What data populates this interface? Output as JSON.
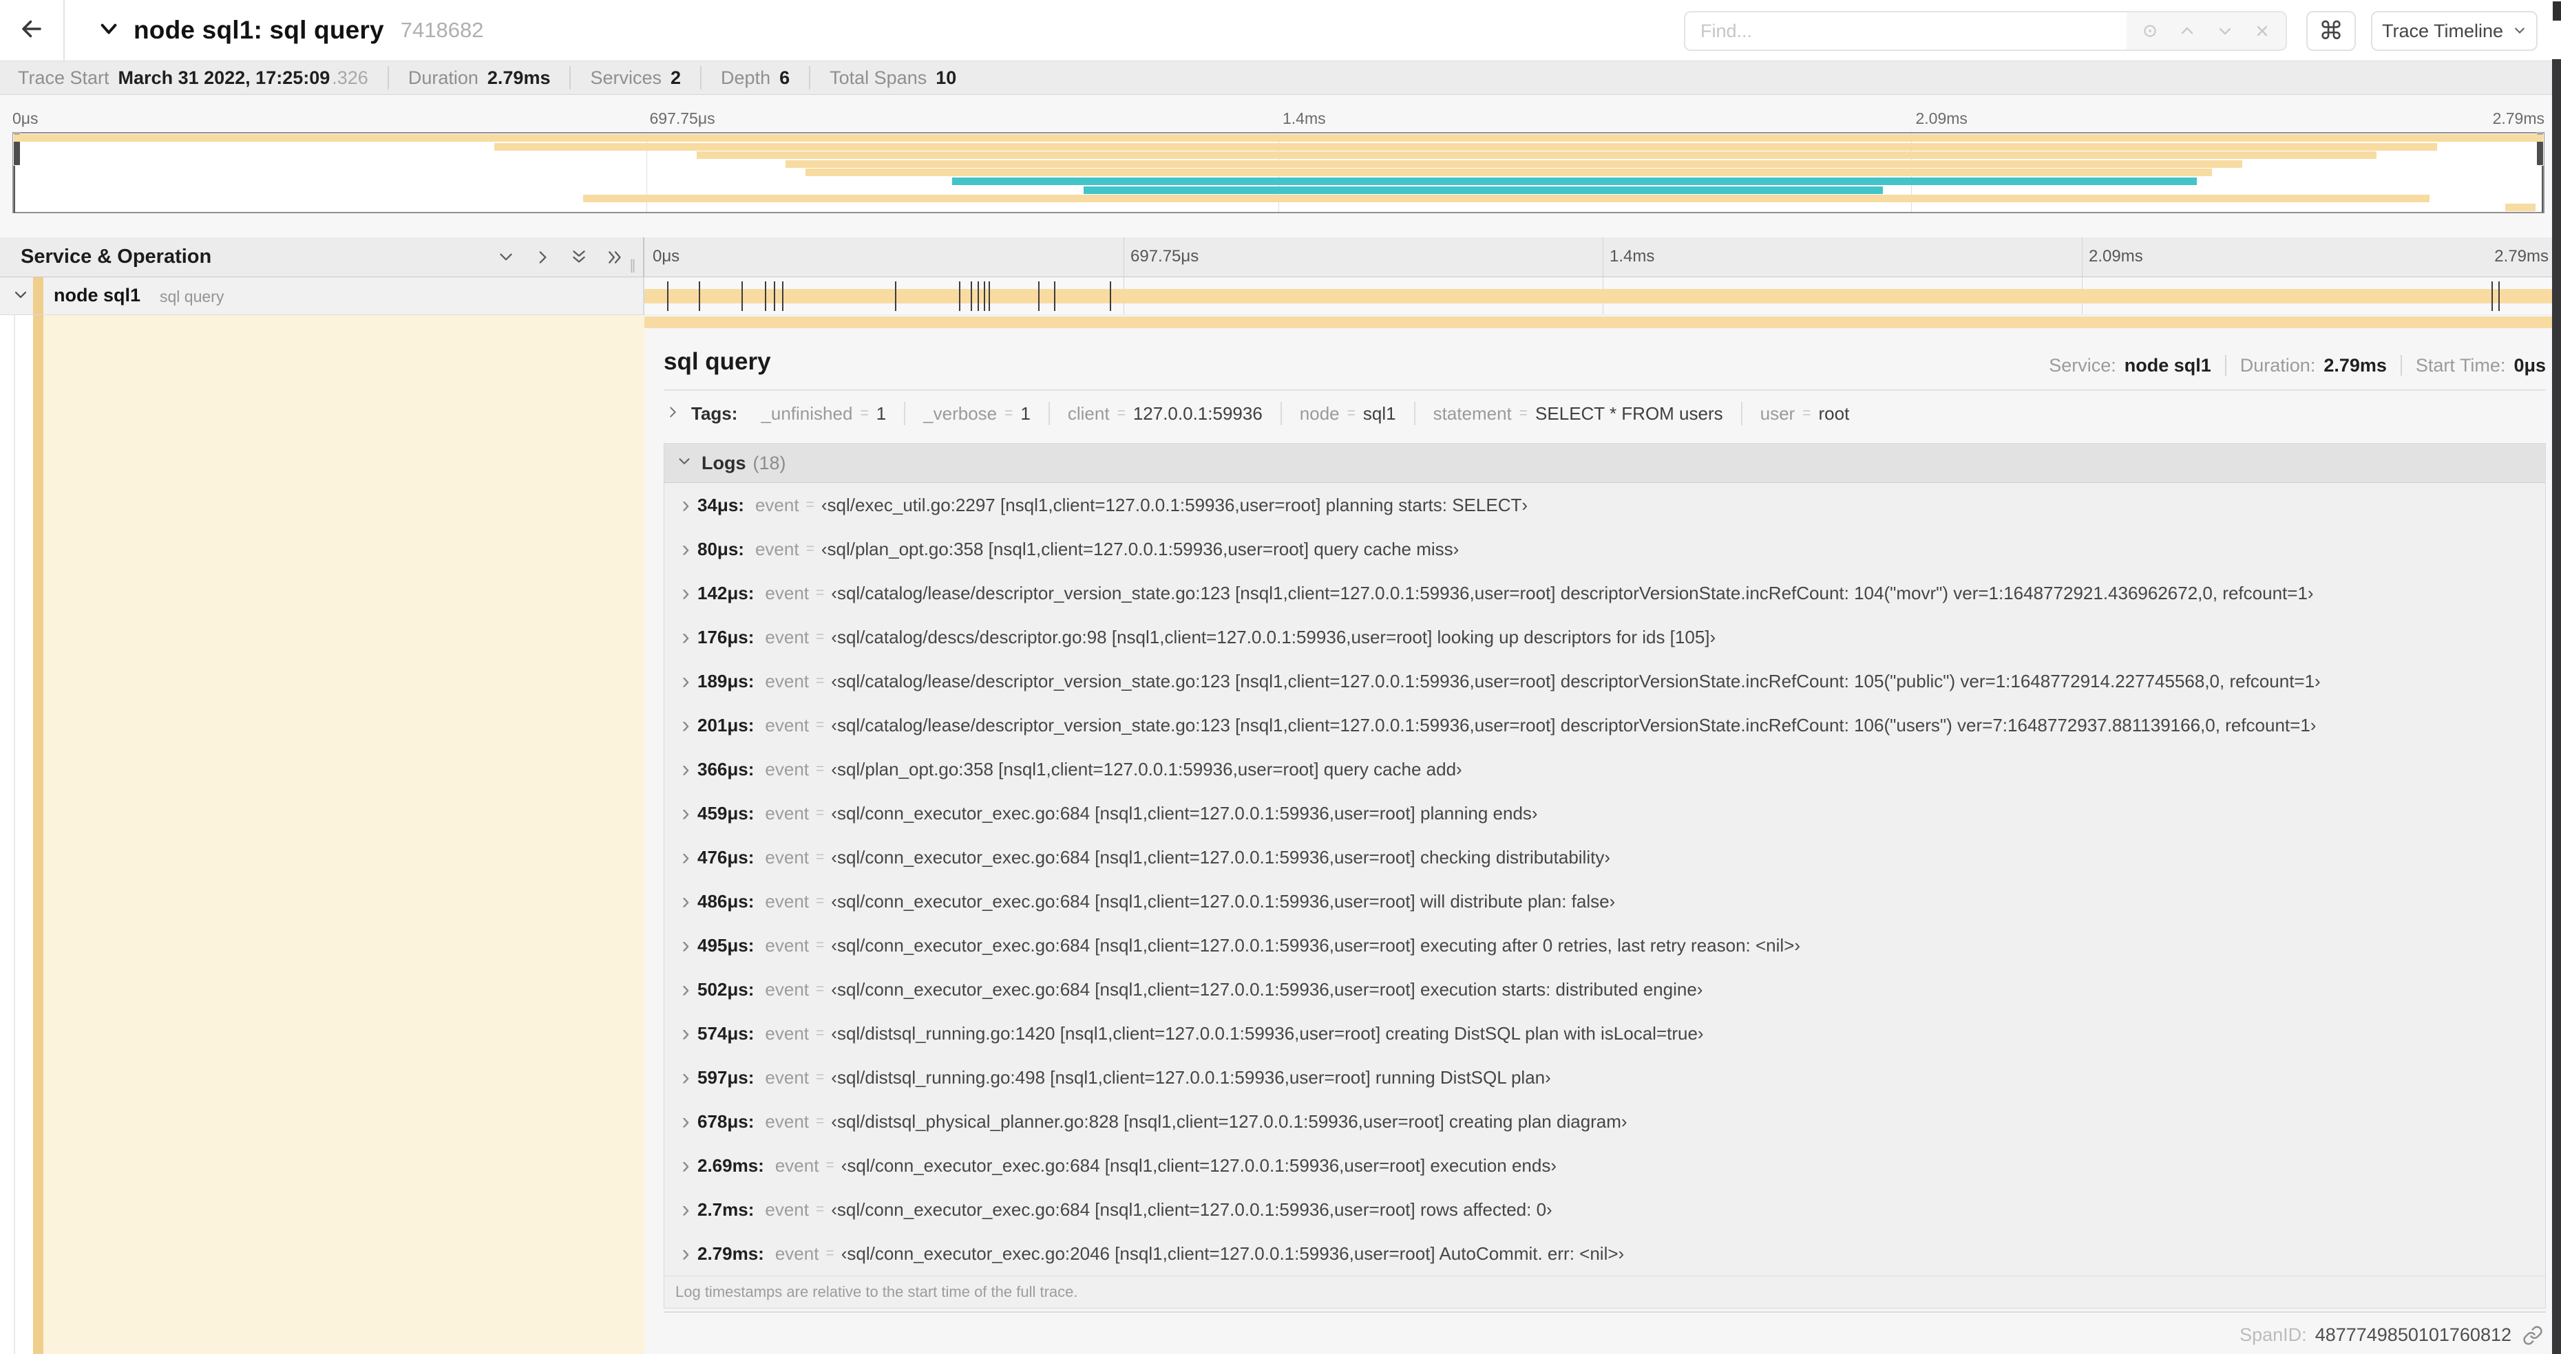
{
  "header": {
    "title": "node sql1: sql query",
    "trace_id": "7418682",
    "find_placeholder": "Find...",
    "command_key_glyph": "⌘",
    "view_selector_label": "Trace Timeline"
  },
  "trace_stats": {
    "trace_start_label": "Trace Start",
    "trace_start_value": "March 31 2022, 17:25:09",
    "trace_start_fraction": ".326",
    "duration_label": "Duration",
    "duration_value": "2.79ms",
    "services_label": "Services",
    "services_value": "2",
    "depth_label": "Depth",
    "depth_value": "6",
    "total_spans_label": "Total Spans",
    "total_spans_value": "10"
  },
  "minimap": {
    "tick_labels": [
      "0μs",
      "697.75μs",
      "1.4ms",
      "2.09ms",
      "2.79ms"
    ],
    "spans": [
      {
        "row": 0,
        "start": 0.0,
        "end": 1.0,
        "color": "tan"
      },
      {
        "row": 1,
        "start": 0.19,
        "end": 0.958,
        "color": "tan"
      },
      {
        "row": 2,
        "start": 0.27,
        "end": 0.934,
        "color": "tan"
      },
      {
        "row": 3,
        "start": 0.305,
        "end": 0.881,
        "color": "tan"
      },
      {
        "row": 4,
        "start": 0.313,
        "end": 0.869,
        "color": "tan"
      },
      {
        "row": 5,
        "start": 0.371,
        "end": 0.863,
        "color": "teal"
      },
      {
        "row": 6,
        "start": 0.423,
        "end": 0.739,
        "color": "teal"
      },
      {
        "row": 7,
        "start": 0.225,
        "end": 0.955,
        "color": "tan"
      },
      {
        "row": 8,
        "start": 0.985,
        "end": 0.997,
        "color": "tan"
      }
    ]
  },
  "timeline": {
    "left_header": "Service & Operation",
    "ruler_ticks": [
      "0μs",
      "697.75μs",
      "1.4ms",
      "2.09ms",
      "2.79ms"
    ],
    "span_row": {
      "service": "node sql1",
      "operation": "sql query"
    },
    "log_tick_times_us": [
      34,
      80,
      142,
      176,
      189,
      201,
      366,
      459,
      476,
      486,
      495,
      502,
      574,
      597,
      678,
      2690,
      2700,
      2790
    ],
    "total_us": 2790,
    "column_grip_glyph": "∥"
  },
  "detail": {
    "title": "sql query",
    "service_label": "Service:",
    "service_value": "node sql1",
    "duration_label": "Duration:",
    "duration_value": "2.79ms",
    "start_time_label": "Start Time:",
    "start_time_value": "0μs",
    "tags_label": "Tags:",
    "tags": [
      {
        "key": "_unfinished",
        "value": "1"
      },
      {
        "key": "_verbose",
        "value": "1"
      },
      {
        "key": "client",
        "value": "127.0.0.1:59936"
      },
      {
        "key": "node",
        "value": "sql1"
      },
      {
        "key": "statement",
        "value": "SELECT * FROM users"
      },
      {
        "key": "user",
        "value": "root"
      }
    ],
    "logs_label": "Logs",
    "logs_count": "(18)",
    "log_field_name": "event",
    "logs": [
      {
        "time": "34μs:",
        "value": "‹sql/exec_util.go:2297 [nsql1,client=127.0.0.1:59936,user=root] planning starts: SELECT›"
      },
      {
        "time": "80μs:",
        "value": "‹sql/plan_opt.go:358 [nsql1,client=127.0.0.1:59936,user=root] query cache miss›"
      },
      {
        "time": "142μs:",
        "value": "‹sql/catalog/lease/descriptor_version_state.go:123 [nsql1,client=127.0.0.1:59936,user=root] descriptorVersionState.incRefCount: 104(\"movr\") ver=1:1648772921.436962672,0, refcount=1›"
      },
      {
        "time": "176μs:",
        "value": "‹sql/catalog/descs/descriptor.go:98 [nsql1,client=127.0.0.1:59936,user=root] looking up descriptors for ids [105]›"
      },
      {
        "time": "189μs:",
        "value": "‹sql/catalog/lease/descriptor_version_state.go:123 [nsql1,client=127.0.0.1:59936,user=root] descriptorVersionState.incRefCount: 105(\"public\") ver=1:1648772914.227745568,0, refcount=1›"
      },
      {
        "time": "201μs:",
        "value": "‹sql/catalog/lease/descriptor_version_state.go:123 [nsql1,client=127.0.0.1:59936,user=root] descriptorVersionState.incRefCount: 106(\"users\") ver=7:1648772937.881139166,0, refcount=1›"
      },
      {
        "time": "366μs:",
        "value": "‹sql/plan_opt.go:358 [nsql1,client=127.0.0.1:59936,user=root] query cache add›"
      },
      {
        "time": "459μs:",
        "value": "‹sql/conn_executor_exec.go:684 [nsql1,client=127.0.0.1:59936,user=root] planning ends›"
      },
      {
        "time": "476μs:",
        "value": "‹sql/conn_executor_exec.go:684 [nsql1,client=127.0.0.1:59936,user=root] checking distributability›"
      },
      {
        "time": "486μs:",
        "value": "‹sql/conn_executor_exec.go:684 [nsql1,client=127.0.0.1:59936,user=root] will distribute plan: false›"
      },
      {
        "time": "495μs:",
        "value": "‹sql/conn_executor_exec.go:684 [nsql1,client=127.0.0.1:59936,user=root] executing after 0 retries, last retry reason: <nil>›"
      },
      {
        "time": "502μs:",
        "value": "‹sql/conn_executor_exec.go:684 [nsql1,client=127.0.0.1:59936,user=root] execution starts: distributed engine›"
      },
      {
        "time": "574μs:",
        "value": "‹sql/distsql_running.go:1420 [nsql1,client=127.0.0.1:59936,user=root] creating DistSQL plan with isLocal=true›"
      },
      {
        "time": "597μs:",
        "value": "‹sql/distsql_running.go:498 [nsql1,client=127.0.0.1:59936,user=root] running DistSQL plan›"
      },
      {
        "time": "678μs:",
        "value": "‹sql/distsql_physical_planner.go:828 [nsql1,client=127.0.0.1:59936,user=root] creating plan diagram›"
      },
      {
        "time": "2.69ms:",
        "value": "‹sql/conn_executor_exec.go:684 [nsql1,client=127.0.0.1:59936,user=root] execution ends›"
      },
      {
        "time": "2.7ms:",
        "value": "‹sql/conn_executor_exec.go:684 [nsql1,client=127.0.0.1:59936,user=root] rows affected: 0›"
      },
      {
        "time": "2.79ms:",
        "value": "‹sql/conn_executor_exec.go:2046 [nsql1,client=127.0.0.1:59936,user=root] AutoCommit. err: <nil>›"
      }
    ],
    "logs_footer": "Log timestamps are relative to the start time of the full trace.",
    "spanid_label": "SpanID:",
    "spanid_value": "4877749850101760812"
  },
  "colors": {
    "span_tan": "#F7DBA1",
    "span_teal": "#43C4C9",
    "accent_strip": "#F0CE8C",
    "detail_cream": "#FCF3DC"
  }
}
